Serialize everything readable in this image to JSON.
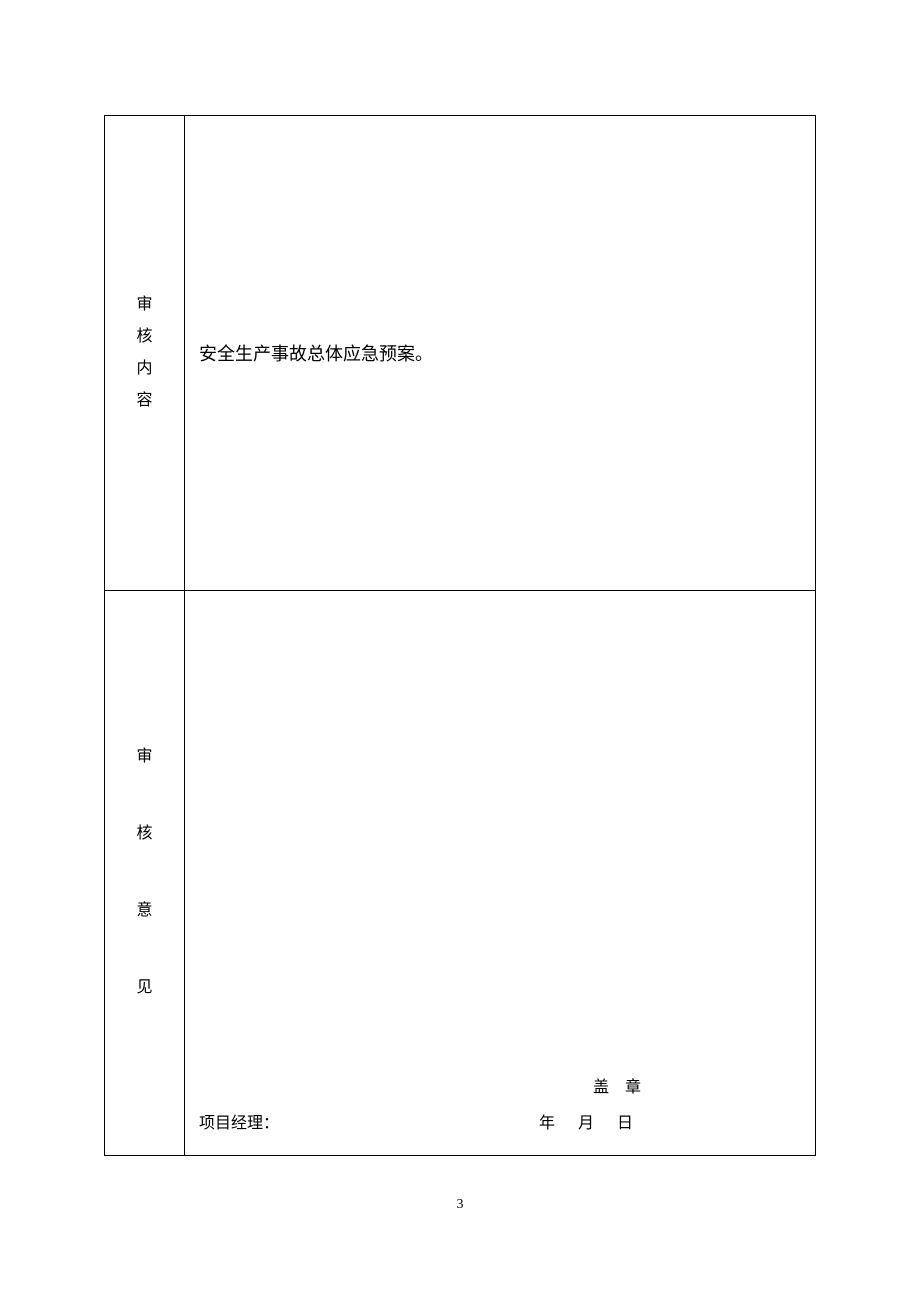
{
  "rows": [
    {
      "label_chars": [
        "审",
        "核",
        "内",
        "容"
      ],
      "content": "安全生产事故总体应急预案。"
    },
    {
      "label_chars": [
        "审",
        "核",
        "意",
        "见"
      ],
      "stamp_label": "盖",
      "stamp_label2": "章",
      "signature_role": "项目经理：",
      "date_year": "年",
      "date_month": "月",
      "date_day": "日"
    }
  ],
  "page_number": "3"
}
